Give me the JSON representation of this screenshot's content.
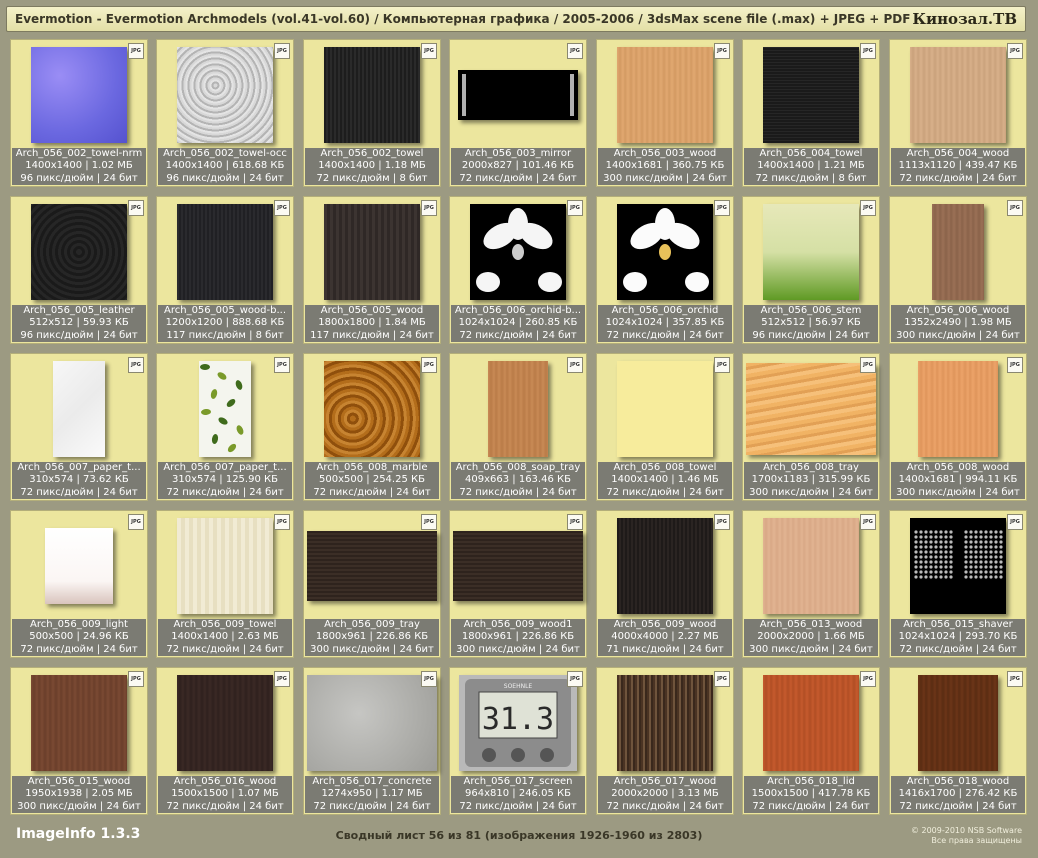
{
  "header": {
    "title": "Evermotion - Evermotion Archmodels (vol.41-vol.60) / Компьютерная графика / 2005-2006 / 3dsMax scene file (.max) + JPEG + PDF",
    "brand": "Кинозал.ТВ"
  },
  "badge_label": "JPG",
  "items": [
    {
      "name": "Arch_056_002_towel-nrm",
      "size": "1400x1400 | 1.02 МБ",
      "meta": "96 пикс/дюйм | 24 бит",
      "icon": "normal-map-texture"
    },
    {
      "name": "Arch_056_002_towel-occ",
      "size": "1400x1400 | 618.68 КБ",
      "meta": "96 пикс/дюйм | 24 бит",
      "icon": "occlusion-texture"
    },
    {
      "name": "Arch_056_002_towel",
      "size": "1400x1400 | 1.18 МБ",
      "meta": "72 пикс/дюйм | 8 бит",
      "icon": "towel-texture"
    },
    {
      "name": "Arch_056_003_mirror",
      "size": "2000x827 | 101.46 КБ",
      "meta": "72 пикс/дюйм | 24 бит",
      "icon": "mirror-texture"
    },
    {
      "name": "Arch_056_003_wood",
      "size": "1400x1681 | 360.75 КБ",
      "meta": "300 пикс/дюйм | 24 бит",
      "icon": "wood-texture"
    },
    {
      "name": "Arch_056_004_towel",
      "size": "1400x1400 | 1.21 МБ",
      "meta": "72 пикс/дюйм | 8 бит",
      "icon": "towel-texture"
    },
    {
      "name": "Arch_056_004_wood",
      "size": "1113x1120 | 439.47 КБ",
      "meta": "72 пикс/дюйм | 24 бит",
      "icon": "wood-texture"
    },
    {
      "name": "Arch_056_005_leather",
      "size": "512x512 | 59.93 КБ",
      "meta": "96 пикс/дюйм | 24 бит",
      "icon": "leather-texture"
    },
    {
      "name": "Arch_056_005_wood-b...",
      "size": "1200x1200 | 888.68 КБ",
      "meta": "117 пикс/дюйм | 8 бит",
      "icon": "wood-texture"
    },
    {
      "name": "Arch_056_005_wood",
      "size": "1800x1800 | 1.84 МБ",
      "meta": "117 пикс/дюйм | 24 бит",
      "icon": "wood-texture"
    },
    {
      "name": "Arch_056_006_orchid-b...",
      "size": "1024x1024 | 260.85 КБ",
      "meta": "72 пикс/дюйм | 24 бит",
      "icon": "orchid-texture"
    },
    {
      "name": "Arch_056_006_orchid",
      "size": "1024x1024 | 357.85 КБ",
      "meta": "72 пикс/дюйм | 24 бит",
      "icon": "orchid-texture"
    },
    {
      "name": "Arch_056_006_stem",
      "size": "512x512 | 56.97 КБ",
      "meta": "96 пикс/дюйм | 24 бит",
      "icon": "stem-texture"
    },
    {
      "name": "Arch_056_006_wood",
      "size": "1352x2490 | 1.98 МБ",
      "meta": "300 пикс/дюйм | 24 бит",
      "icon": "wood-texture"
    },
    {
      "name": "Arch_056_007_paper_t...",
      "size": "310x574 | 73.62 КБ",
      "meta": "72 пикс/дюйм | 24 бит",
      "icon": "paper-texture"
    },
    {
      "name": "Arch_056_007_paper_t...",
      "size": "310x574 | 125.90 КБ",
      "meta": "72 пикс/дюйм | 24 бит",
      "icon": "leaf-paper-texture"
    },
    {
      "name": "Arch_056_008_marble",
      "size": "500x500 | 254.25 КБ",
      "meta": "72 пикс/дюйм | 24 бит",
      "icon": "marble-texture"
    },
    {
      "name": "Arch_056_008_soap_tray",
      "size": "409x663 | 163.46 КБ",
      "meta": "72 пикс/дюйм | 24 бит",
      "icon": "wood-texture"
    },
    {
      "name": "Arch_056_008_towel",
      "size": "1400x1400 | 1.46 МБ",
      "meta": "72 пикс/дюйм | 24 бит",
      "icon": "towel-texture"
    },
    {
      "name": "Arch_056_008_tray",
      "size": "1700x1183 | 315.99 КБ",
      "meta": "300 пикс/дюйм | 24 бит",
      "icon": "wood-texture"
    },
    {
      "name": "Arch_056_008_wood",
      "size": "1400x1681 | 994.11 КБ",
      "meta": "300 пикс/дюйм | 24 бит",
      "icon": "wood-texture"
    },
    {
      "name": "Arch_056_009_light",
      "size": "500x500 | 24.96 КБ",
      "meta": "72 пикс/дюйм | 24 бит",
      "icon": "light-texture"
    },
    {
      "name": "Arch_056_009_towel",
      "size": "1400x1400 | 2.63 МБ",
      "meta": "72 пикс/дюйм | 24 бит",
      "icon": "towel-texture"
    },
    {
      "name": "Arch_056_009_tray",
      "size": "1800x961 | 226.86 КБ",
      "meta": "300 пикс/дюйм | 24 бит",
      "icon": "wood-texture"
    },
    {
      "name": "Arch_056_009_wood1",
      "size": "1800x961 | 226.86 КБ",
      "meta": "300 пикс/дюйм | 24 бит",
      "icon": "wood-texture"
    },
    {
      "name": "Arch_056_009_wood",
      "size": "4000x4000 | 2.27 МБ",
      "meta": "71 пикс/дюйм | 24 бит",
      "icon": "wood-texture"
    },
    {
      "name": "Arch_056_013_wood",
      "size": "2000x2000 | 1.66 МБ",
      "meta": "300 пикс/дюйм | 24 бит",
      "icon": "wood-texture"
    },
    {
      "name": "Arch_056_015_shaver",
      "size": "1024x1024 | 293.70 КБ",
      "meta": "72 пикс/дюйм | 24 бит",
      "icon": "shaver-texture"
    },
    {
      "name": "Arch_056_015_wood",
      "size": "1950x1938 | 2.05 МБ",
      "meta": "300 пикс/дюйм | 24 бит",
      "icon": "wood-texture"
    },
    {
      "name": "Arch_056_016_wood",
      "size": "1500x1500 | 1.07 МБ",
      "meta": "72 пикс/дюйм | 24 бит",
      "icon": "wood-texture"
    },
    {
      "name": "Arch_056_017_concrete",
      "size": "1274x950 | 1.17 МБ",
      "meta": "72 пикс/дюйм | 24 бит",
      "icon": "concrete-texture"
    },
    {
      "name": "Arch_056_017_screen",
      "size": "964x810 | 246.05 КБ",
      "meta": "72 пикс/дюйм | 24 бит",
      "icon": "scale-screen-texture",
      "screen_text": "31.3",
      "screen_brand": "SOEHNLE"
    },
    {
      "name": "Arch_056_017_wood",
      "size": "2000x2000 | 3.13 МБ",
      "meta": "72 пикс/дюйм | 24 бит",
      "icon": "wood-texture"
    },
    {
      "name": "Arch_056_018_lid",
      "size": "1500x1500 | 417.78 КБ",
      "meta": "72 пикс/дюйм | 24 бит",
      "icon": "wood-texture"
    },
    {
      "name": "Arch_056_018_wood",
      "size": "1416x1700 | 276.42 КБ",
      "meta": "72 пикс/дюйм | 24 бит",
      "icon": "wood-texture"
    }
  ],
  "footer": {
    "app": "ImageInfo 1.3.3",
    "status": "Сводный лист 56 из 81 (изображения 1926-1960 из 2803)",
    "copyright": "© 2009-2010 NSB Software",
    "rights": "Все права защищены"
  }
}
